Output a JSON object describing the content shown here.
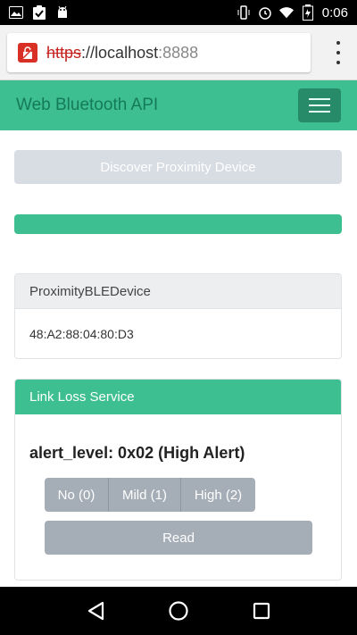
{
  "status_bar": {
    "time": "0:06",
    "left_icons": [
      "image-icon",
      "clipboard-check-icon",
      "android-icon"
    ],
    "right_icons": [
      "vibrate-icon",
      "alarm-icon",
      "wifi-icon",
      "battery-icon"
    ]
  },
  "browser": {
    "url_scheme": "https",
    "url_sep": "://",
    "url_host": "localhost",
    "url_port": ":8888"
  },
  "navbar": {
    "brand": "Web Bluetooth API"
  },
  "main": {
    "discover_label": "Discover Proximity Device",
    "progress": 1.0,
    "device_card": {
      "header": "ProximityBLEDevice",
      "address": "48:A2:88:04:80:D3"
    },
    "service_card": {
      "header": "Link Loss Service",
      "alert_level": "alert_level: 0x02 (High Alert)",
      "options": [
        "No (0)",
        "Mild (1)",
        "High (2)"
      ],
      "read_label": "Read"
    }
  },
  "colors": {
    "accent": "#3dbf91",
    "accent_dark": "#157a59",
    "button_gray": "#a5adb7"
  }
}
